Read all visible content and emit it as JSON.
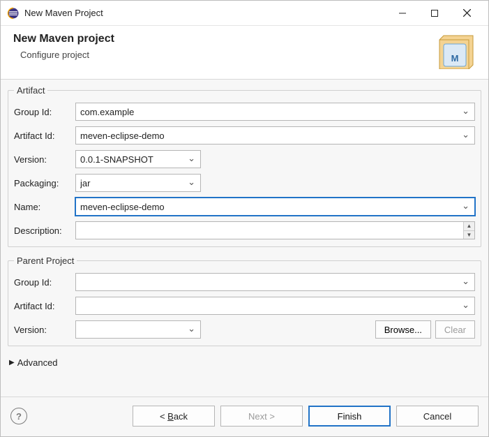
{
  "window": {
    "title": "New Maven Project"
  },
  "banner": {
    "heading": "New Maven project",
    "subtitle": "Configure project"
  },
  "artifact": {
    "legend": "Artifact",
    "group_id_label": "Group Id:",
    "group_id": "com.example",
    "artifact_id_label": "Artifact Id:",
    "artifact_id": "meven-eclipse-demo",
    "version_label": "Version:",
    "version": "0.0.1-SNAPSHOT",
    "packaging_label": "Packaging:",
    "packaging": "jar",
    "name_label": "Name:",
    "name": "meven-eclipse-demo",
    "description_label": "Description:",
    "description": ""
  },
  "parent": {
    "legend": "Parent Project",
    "group_id_label": "Group Id:",
    "group_id": "",
    "artifact_id_label": "Artifact Id:",
    "artifact_id": "",
    "version_label": "Version:",
    "version": "",
    "browse_label": "Browse...",
    "clear_label": "Clear"
  },
  "advanced_label": "Advanced",
  "footer": {
    "back": "Back",
    "next": "Next >",
    "finish": "Finish",
    "cancel": "Cancel"
  }
}
